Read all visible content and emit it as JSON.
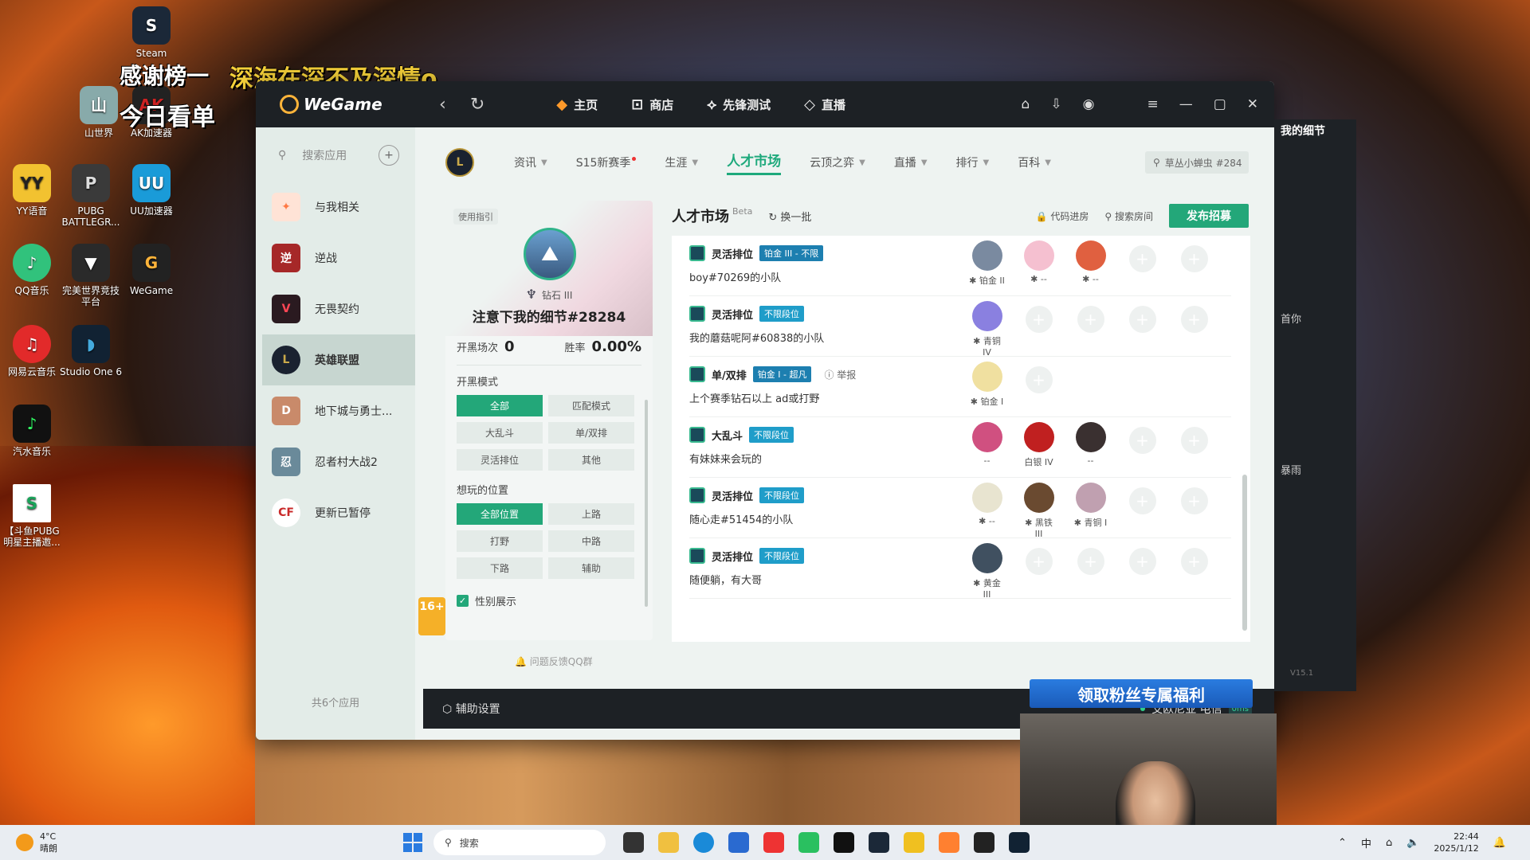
{
  "desktop": {
    "icons": [
      {
        "label": "Steam",
        "color": "#1b2838"
      },
      {
        "label": "YY语音",
        "color": "#f2c230"
      },
      {
        "label": "PUBG BATTLEGR...",
        "color": "#3a3a3a"
      },
      {
        "label": "UU加速器",
        "color": "#1a9bd8"
      },
      {
        "label": "QQ音乐",
        "color": "#31c27c"
      },
      {
        "label": "完美世界竞技平台",
        "color": "#2a2a2a"
      },
      {
        "label": "WeGame",
        "color": "#ffb43a"
      },
      {
        "label": "网易云音乐",
        "color": "#e22a2a"
      },
      {
        "label": "Studio One 6",
        "color": "#123"
      },
      {
        "label": "汽水音乐",
        "color": "#111"
      },
      {
        "label": "【斗鱼PUBG明星主播邀...",
        "color": "#1aa45a"
      },
      {
        "label": "AK加速器",
        "color": "#c22"
      },
      {
        "label": "山世界",
        "color": "#8aa"
      }
    ],
    "overlay_text_1": "感谢榜一",
    "overlay_text_2": "深海在深不及深情o",
    "overlay_text_3": "今日看单"
  },
  "window": {
    "app_name": "WeGame",
    "top_nav": [
      {
        "label": "主页",
        "icon": "home-icon"
      },
      {
        "label": "商店",
        "icon": "shop-icon"
      },
      {
        "label": "先锋测试",
        "icon": "pioneer-icon"
      },
      {
        "label": "直播",
        "icon": "live-icon"
      }
    ]
  },
  "sidebar": {
    "search_placeholder": "搜索应用",
    "items": [
      {
        "label": "与我相关",
        "color": "#ff7a45"
      },
      {
        "label": "逆战",
        "color": "#a62828"
      },
      {
        "label": "无畏契约",
        "color": "#ff4655"
      },
      {
        "label": "英雄联盟",
        "color": "#1a2230"
      },
      {
        "label": "地下城与勇士...",
        "color": "#c98a6a"
      },
      {
        "label": "忍者村大战2",
        "color": "#6a8a9a"
      },
      {
        "label": "更新已暂停",
        "color": "#c92a2a"
      }
    ],
    "footer": "共6个应用"
  },
  "subnav": {
    "items": [
      "资讯",
      "S15新赛季",
      "生涯",
      "人才市场",
      "云顶之弈",
      "直播",
      "排行",
      "百科"
    ],
    "search_text": "草丛小蝉虫 #284"
  },
  "profile": {
    "guide": "使用指引",
    "rank": "钻石 III",
    "name": "注意下我的细节#28284",
    "games_label": "开黑场次",
    "games_value": "0",
    "winrate_label": "胜率",
    "winrate_value": "0.00%",
    "mode_title": "开黑模式",
    "modes": [
      "全部",
      "匹配模式",
      "大乱斗",
      "单/双排",
      "灵活排位",
      "其他"
    ],
    "pos_title": "想玩的位置",
    "positions": [
      "全部位置",
      "上路",
      "打野",
      "中路",
      "下路",
      "辅助"
    ],
    "gender": "性别展示",
    "age": "16+",
    "feedback": "问题反馈QQ群"
  },
  "market": {
    "title": "人才市场",
    "beta": "Beta",
    "refresh": "换一批",
    "code_join": "代码进房",
    "search_room": "搜索房间",
    "publish": "发布招募",
    "rows": [
      {
        "mode": "灵活排位",
        "tag": "铂金 III - 不限",
        "desc": "boy#70269的小队",
        "members": [
          {
            "rank": "✱ 铂金 II",
            "c": "#7a8aa0"
          },
          {
            "rank": "✱ --",
            "c": "#f5c0d0"
          },
          {
            "rank": "✱ --",
            "c": "#e06040"
          }
        ]
      },
      {
        "mode": "灵活排位",
        "tag": "不限段位",
        "desc": "我的蘑菇呢阿#60838的小队",
        "members": [
          {
            "rank": "✱ 青铜 IV",
            "c": "#8a80e0"
          }
        ]
      },
      {
        "mode": "单/双排",
        "tag": "铂金 I - 超凡",
        "desc": "上个赛季钻石以上 ad或打野",
        "report": "举报",
        "members": [
          {
            "rank": "✱ 铂金 I",
            "c": "#f0e0a0"
          }
        ]
      },
      {
        "mode": "大乱斗",
        "tag": "不限段位",
        "desc": "有妹妹来会玩的",
        "members": [
          {
            "rank": "--",
            "c": "#d05080"
          },
          {
            "rank": "白银 IV",
            "c": "#c02020"
          },
          {
            "rank": "--",
            "c": "#3a3030"
          }
        ]
      },
      {
        "mode": "灵活排位",
        "tag": "不限段位",
        "desc": "随心走#51454的小队",
        "members": [
          {
            "rank": "✱ --",
            "c": "#e8e4d0"
          },
          {
            "rank": "✱ 黑铁 III",
            "c": "#6a4a30"
          },
          {
            "rank": "✱ 青铜 I",
            "c": "#c0a0b0"
          }
        ]
      },
      {
        "mode": "灵活排位",
        "tag": "不限段位",
        "desc": "随便躺，有大哥",
        "members": [
          {
            "rank": "✱ 黄金 III",
            "c": "#405060"
          }
        ]
      }
    ]
  },
  "bottom": {
    "assist": "辅助设置",
    "server": "艾欧尼亚 电信",
    "ping": "0ms"
  },
  "side_panel": {
    "title": "我的细节",
    "text1": "首你",
    "text2": "暴雨",
    "version": "V15.1"
  },
  "fan_banner": "领取粉丝专属福利",
  "taskbar": {
    "temp": "4°C",
    "weather": "晴朗",
    "search": "搜索",
    "ime": "中",
    "time": "22:44",
    "date": "2025/1/12"
  }
}
